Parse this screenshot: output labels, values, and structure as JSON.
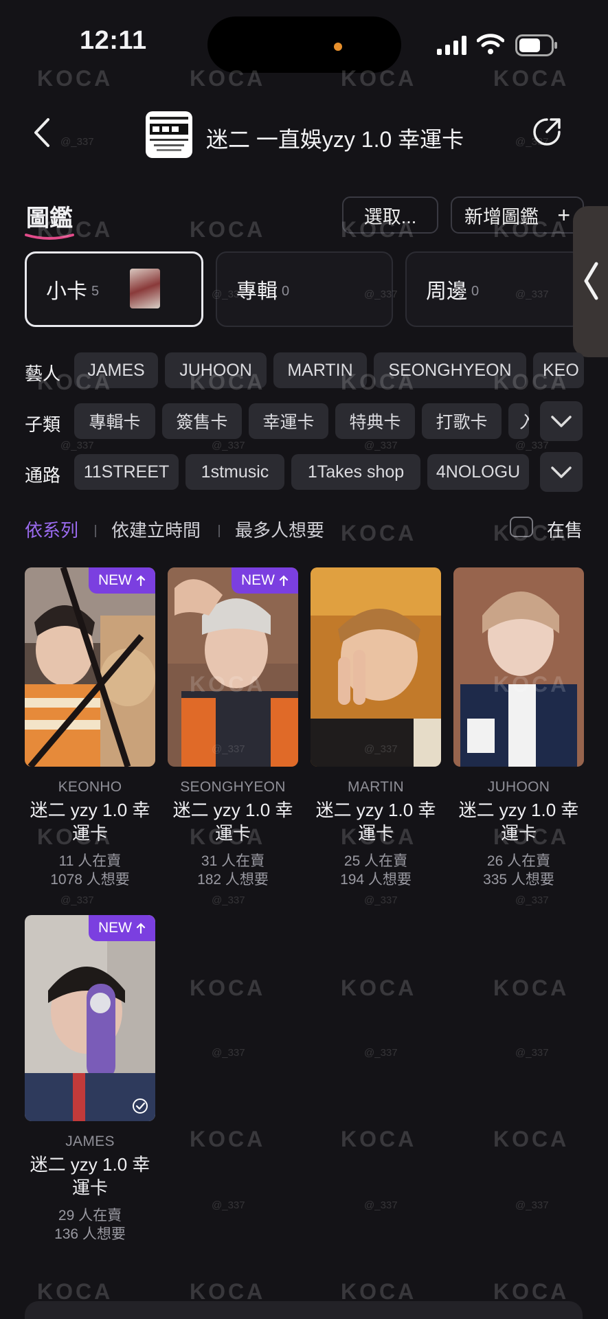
{
  "status": {
    "time": "12:11"
  },
  "header": {
    "title": "迷二 一直娛yzy 1.0 幸運卡"
  },
  "section": {
    "title": "圖鑑",
    "select_label": "選取...",
    "add_label": "新增圖鑑",
    "add_icon": "+"
  },
  "categories": [
    {
      "label": "小卡",
      "count": "5"
    },
    {
      "label": "專輯",
      "count": "0"
    },
    {
      "label": "周邊",
      "count": "0"
    }
  ],
  "filters": {
    "artist": {
      "label": "藝人",
      "options": [
        "JAMES",
        "JUHOON",
        "MARTIN",
        "SEONGHYEON",
        "KEO"
      ]
    },
    "subtype": {
      "label": "子類",
      "options": [
        "專輯卡",
        "簽售卡",
        "幸運卡",
        "特典卡",
        "打歌卡",
        "入"
      ]
    },
    "channel": {
      "label": "通路",
      "options": [
        "11STREET",
        "1stmusic",
        "1Takes shop",
        "4NOLOGU"
      ]
    }
  },
  "sort": {
    "options": [
      "依系列",
      "依建立時間",
      "最多人想要"
    ],
    "active": "依系列",
    "on_sale_label": "在售"
  },
  "new_badge": "NEW",
  "cards": [
    {
      "artist": "KEONHO",
      "name": "迷二 yzy 1.0 幸運卡",
      "selling": "11 人在賣",
      "wanting": "1078 人想要"
    },
    {
      "artist": "SEONGHYEON",
      "name": "迷二 yzy 1.0 幸運卡",
      "selling": "31 人在賣",
      "wanting": "182 人想要"
    },
    {
      "artist": "MARTIN",
      "name": "迷二 yzy 1.0 幸運卡",
      "selling": "25 人在賣",
      "wanting": "194 人想要"
    },
    {
      "artist": "JUHOON",
      "name": "迷二 yzy 1.0 幸運卡",
      "selling": "26 人在賣",
      "wanting": "335 人想要"
    },
    {
      "artist": "JAMES",
      "name": "迷二 yzy 1.0 幸運卡",
      "selling": "29 人在賣",
      "wanting": "136 人想要"
    }
  ],
  "watermark": {
    "brand": "KOCA",
    "handle": "@_337"
  },
  "colors": {
    "background": "#141317",
    "accent": "#9b6bf0",
    "badge": "#7b3fe0",
    "chip": "#2b2b31"
  }
}
